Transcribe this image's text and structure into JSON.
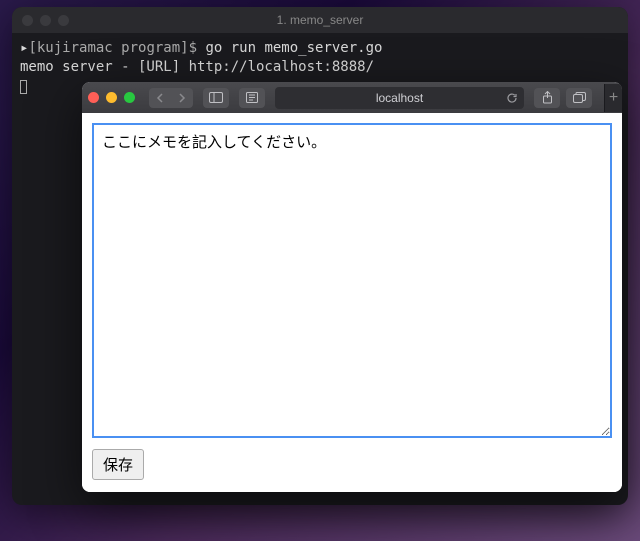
{
  "terminal": {
    "title": "1. memo_server",
    "prompt_user_host": "[kujiramac program]$",
    "command": " go run memo_server.go",
    "output_line": "memo server - [URL] http://localhost:8888/"
  },
  "browser": {
    "address": "localhost",
    "newtab_glyph": "+"
  },
  "page": {
    "memo_value": "ここにメモを記入してください。",
    "save_label": "保存"
  }
}
